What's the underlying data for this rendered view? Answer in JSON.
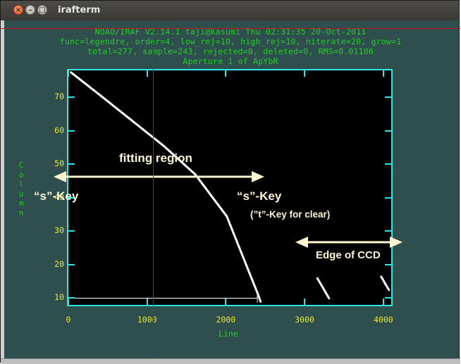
{
  "window": {
    "title": "irafterm"
  },
  "header": {
    "line1": "NOAO/IRAF V2.14.1 taji@kasumi Thu 02:31:35 20-Oct-2011",
    "line2": "func=legendre, order=4, low_rej=10, high_rej=10, niterate=20, grow=1",
    "line3": "total=277, sample=243, rejected=0, deleted=0, RMS=0.01106",
    "line4": "Aperture 1 of ApYbR"
  },
  "chart_data": {
    "type": "scatter",
    "xlabel": "Line",
    "ylabel": "Column",
    "xlim": [
      0,
      4100
    ],
    "ylim": [
      8,
      78
    ],
    "x_ticks": [
      0,
      1000,
      2000,
      3000,
      4000
    ],
    "y_ticks": [
      10,
      20,
      30,
      40,
      50,
      60,
      70
    ],
    "grid": false,
    "series": [
      {
        "x": [
          20,
          400,
          800,
          1200,
          1600,
          2000,
          2400,
          2430
        ],
        "y": [
          77.5,
          70.5,
          63.0,
          55.5,
          47.0,
          34.5,
          11.0,
          9.0
        ]
      },
      {
        "x": [
          3150,
          3200,
          3250,
          3300
        ],
        "y": [
          16.0,
          14.0,
          12.0,
          10.0
        ]
      },
      {
        "x": [
          3960,
          4010,
          4060
        ],
        "y": [
          16.5,
          14.5,
          12.5
        ]
      }
    ],
    "sample_range": {
      "x": [
        0,
        2400
      ],
      "y": 10
    }
  },
  "annotations": {
    "fitting_region": "fitting region",
    "s_key_left": "“s”-Key",
    "s_key_right": "“s”-Key",
    "t_key": "(”t”-Key for clear)",
    "edge_ccd": "Edge of CCD"
  },
  "colors": {
    "frame": "#2ee6e6",
    "ticks_labels": "#e6e632",
    "header_text": "#22cc22",
    "data": "#ffffff",
    "arrows": "#fff3d0",
    "cursor": "#c81414",
    "background": "#2f4f4f"
  }
}
